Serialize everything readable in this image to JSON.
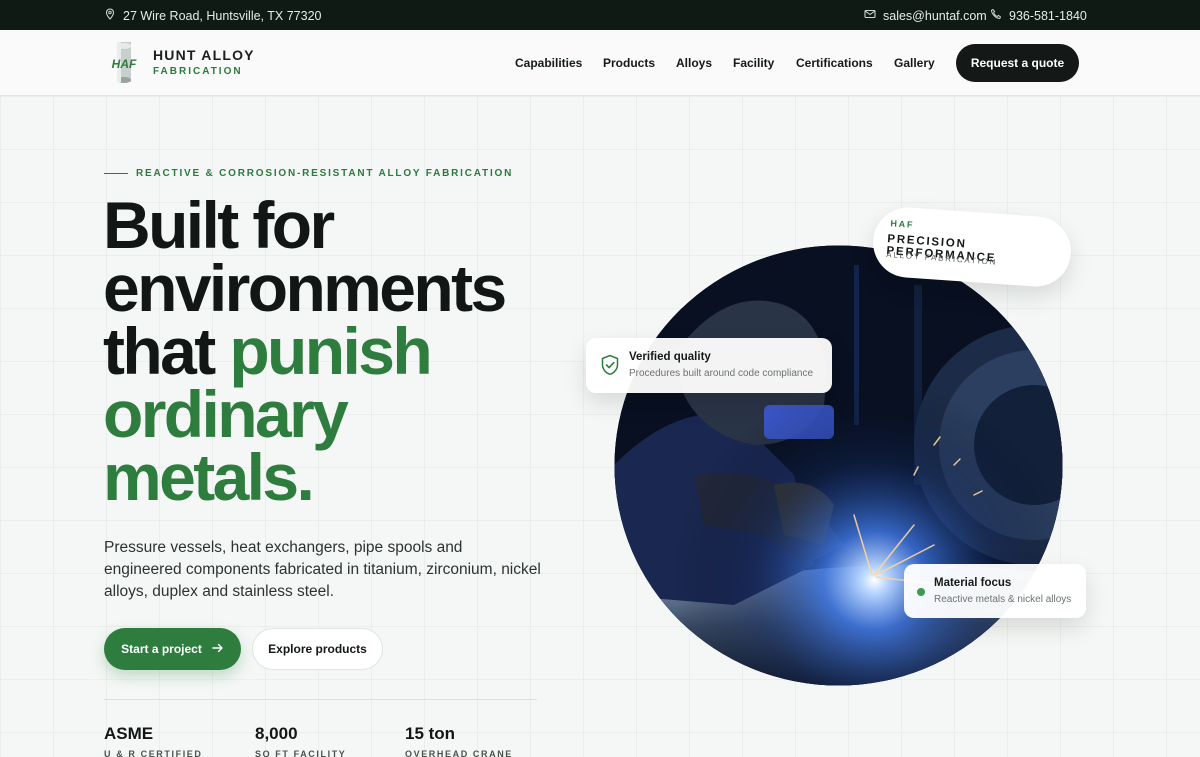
{
  "topbar": {
    "address": "27 Wire Road, Huntsville, TX 77320",
    "email": "sales@huntaf.com",
    "phone": "936-581-1840"
  },
  "brand": {
    "logo_text": "HAF",
    "name_line1": "HUNT ALLOY",
    "name_line2": "FABRICATION"
  },
  "nav": {
    "items": [
      "Capabilities",
      "Products",
      "Alloys",
      "Facility",
      "Certifications",
      "Gallery"
    ],
    "cta": "Request a quote"
  },
  "hero": {
    "eyebrow": "REACTIVE & CORROSION-RESISTANT ALLOY FABRICATION",
    "headline_dark1": "Built for",
    "headline_dark2": "environments",
    "headline_dark3": "that",
    "headline_green1": "punish",
    "headline_green2": "ordinary",
    "headline_green3": "metals.",
    "subtext": "Pressure vessels, heat exchangers, pipe spools and engineered components fabricated in titanium, zirconium, nickel alloys, duplex and stainless steel.",
    "primary_cta": "Start a project",
    "secondary_cta": "Explore products"
  },
  "stats": [
    {
      "value": "ASME",
      "label": "U & R CERTIFIED"
    },
    {
      "value": "8,000",
      "label": "SQ FT FACILITY"
    },
    {
      "value": "15 ton",
      "label": "OVERHEAD CRANE"
    }
  ],
  "cards": {
    "verified_title": "Verified quality",
    "verified_sub": "Procedures built around code compliance",
    "material_title": "Material focus",
    "material_sub": "Reactive metals & nickel alloys"
  },
  "badge": {
    "line1": "HAF",
    "line2": "PRECISION PERFORMANCE",
    "line3": "ALLOY FABRICATION"
  },
  "colors": {
    "accent_green": "#2e7d3e",
    "dark": "#141816",
    "topbar_bg": "#0f1a14"
  }
}
